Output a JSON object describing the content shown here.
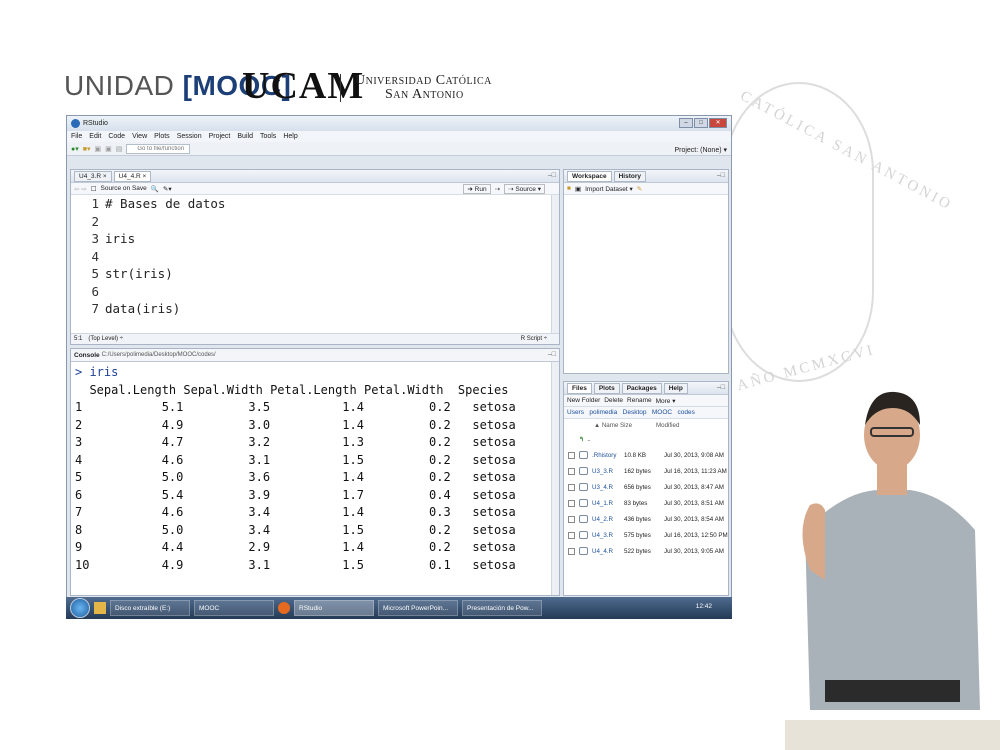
{
  "header": {
    "unidad_prefix": "UNIDAD ",
    "unidad_mooc": "[MOOC]",
    "ucam": "UCAM",
    "uni_line1": "Universidad Católica",
    "uni_line2": "San Antonio"
  },
  "seal": {
    "text": "CATÓLICA SAN ANTONIO",
    "bottom": "AÑO MCMXCVI"
  },
  "window": {
    "title": "RStudio",
    "menu": [
      "File",
      "Edit",
      "Code",
      "View",
      "Plots",
      "Session",
      "Project",
      "Build",
      "Tools",
      "Help"
    ],
    "goto_placeholder": "Go to file/function",
    "project": "Project: (None) ▾"
  },
  "editor": {
    "tabs": [
      "U4_3.R ×",
      "U4_4.R ×"
    ],
    "source_on_save": "Source on Save",
    "run": "Run",
    "source": "Source ▾",
    "lines": [
      {
        "n": "1",
        "code": "# Bases de datos"
      },
      {
        "n": "2",
        "code": ""
      },
      {
        "n": "3",
        "code": "iris"
      },
      {
        "n": "4",
        "code": ""
      },
      {
        "n": "5",
        "code": "str(iris)"
      },
      {
        "n": "6",
        "code": ""
      },
      {
        "n": "7",
        "code": "data(iris)"
      }
    ],
    "status_pos": "5:1",
    "status_level": "(Top Level) ÷",
    "status_type": "R Script ÷"
  },
  "console": {
    "label": "Console",
    "path": "C:/Users/polimedia/Desktop/MOOC/codes/",
    "prompt": "> iris",
    "header": "  Sepal.Length Sepal.Width Petal.Length Petal.Width  Species",
    "rows": [
      "1           5.1         3.5          1.4         0.2   setosa",
      "2           4.9         3.0          1.4         0.2   setosa",
      "3           4.7         3.2          1.3         0.2   setosa",
      "4           4.6         3.1          1.5         0.2   setosa",
      "5           5.0         3.6          1.4         0.2   setosa",
      "6           5.4         3.9          1.7         0.4   setosa",
      "7           4.6         3.4          1.4         0.3   setosa",
      "8           5.0         3.4          1.5         0.2   setosa",
      "9           4.4         2.9          1.4         0.2   setosa",
      "10          4.9         3.1          1.5         0.1   setosa"
    ]
  },
  "workspace": {
    "tabs": [
      "Workspace",
      "History"
    ],
    "import": "Import Dataset ▾"
  },
  "files": {
    "tabs": [
      "Files",
      "Plots",
      "Packages",
      "Help"
    ],
    "new_folder": "New Folder",
    "delete": "Delete",
    "rename": "Rename",
    "more": "More ▾",
    "breadcrumb": "Users   polimedia   Desktop   MOOC   codes",
    "col_name": "▲ Name",
    "col_size": "Size",
    "col_modified": "Modified",
    "up": "..",
    "items": [
      {
        "name": ".Rhistory",
        "size": "10.8 KB",
        "modified": "Jul 30, 2013, 9:08 AM"
      },
      {
        "name": "U3_3.R",
        "size": "162 bytes",
        "modified": "Jul 16, 2013, 11:23 AM"
      },
      {
        "name": "U3_4.R",
        "size": "656 bytes",
        "modified": "Jul 30, 2013, 8:47 AM"
      },
      {
        "name": "U4_1.R",
        "size": "83 bytes",
        "modified": "Jul 30, 2013, 8:51 AM"
      },
      {
        "name": "U4_2.R",
        "size": "436 bytes",
        "modified": "Jul 30, 2013, 8:54 AM"
      },
      {
        "name": "U4_3.R",
        "size": "575 bytes",
        "modified": "Jul 16, 2013, 12:50 PM"
      },
      {
        "name": "U4_4.R",
        "size": "522 bytes",
        "modified": "Jul 30, 2013, 9:05 AM"
      }
    ]
  },
  "taskbar": {
    "items": [
      "Disco extraíble (E:)",
      "MOOC",
      "RStudio",
      "Microsoft PowerPoin...",
      "Presentación de Pow..."
    ],
    "clock": "12:42"
  }
}
